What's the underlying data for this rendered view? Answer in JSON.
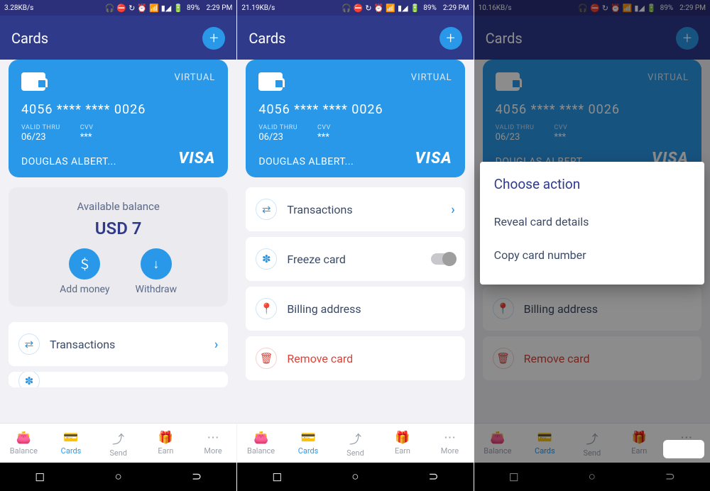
{
  "screens": [
    {
      "status": {
        "net": "3.28KB/s",
        "batt": "89%",
        "time": "2:29 PM"
      }
    },
    {
      "status": {
        "net": "21.19KB/s",
        "batt": "89%",
        "time": "2:29 PM"
      }
    },
    {
      "status": {
        "net": "10.16KB/s",
        "batt": "89%",
        "time": "2:29 PM"
      }
    }
  ],
  "header": {
    "title": "Cards"
  },
  "card": {
    "virtual": "VIRTUAL",
    "number": "4056  ****  ****  0026",
    "valid_label": "VALID THRU",
    "valid": "06/23",
    "cvv_label": "CVV",
    "cvv": "***",
    "holder": "DOUGLAS ALBERT...",
    "brand": "VISA"
  },
  "balance": {
    "label": "Available balance",
    "amount": "USD 7",
    "add": "Add money",
    "withdraw": "Withdraw"
  },
  "rows": {
    "transactions": "Transactions",
    "freeze": "Freeze card",
    "billing": "Billing address",
    "remove": "Remove card"
  },
  "nav": {
    "balance": "Balance",
    "cards": "Cards",
    "send": "Send",
    "earn": "Earn",
    "more": "More"
  },
  "sheet": {
    "title": "Choose action",
    "reveal": "Reveal card details",
    "copy": "Copy card number"
  }
}
